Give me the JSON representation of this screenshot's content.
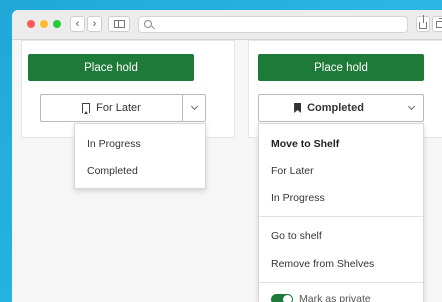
{
  "browser": {
    "back_symbol": "‹",
    "forward_symbol": "›"
  },
  "left_card": {
    "place_hold_label": "Place hold",
    "shelf_button_label": "For Later",
    "menu": [
      {
        "label": "In Progress"
      },
      {
        "label": "Completed"
      }
    ]
  },
  "right_card": {
    "place_hold_label": "Place hold",
    "shelf_button_label": "Completed",
    "menu_heading": "Move to Shelf",
    "menu": [
      {
        "label": "For Later"
      },
      {
        "label": "In Progress"
      }
    ],
    "actions": [
      {
        "label": "Go to shelf"
      },
      {
        "label": "Remove from Shelves"
      }
    ],
    "private_toggle_label": "Mark as private",
    "private_toggle_on": true
  },
  "colors": {
    "primary_green": "#1d7a38",
    "backdrop_blue": "#27b4e2"
  }
}
